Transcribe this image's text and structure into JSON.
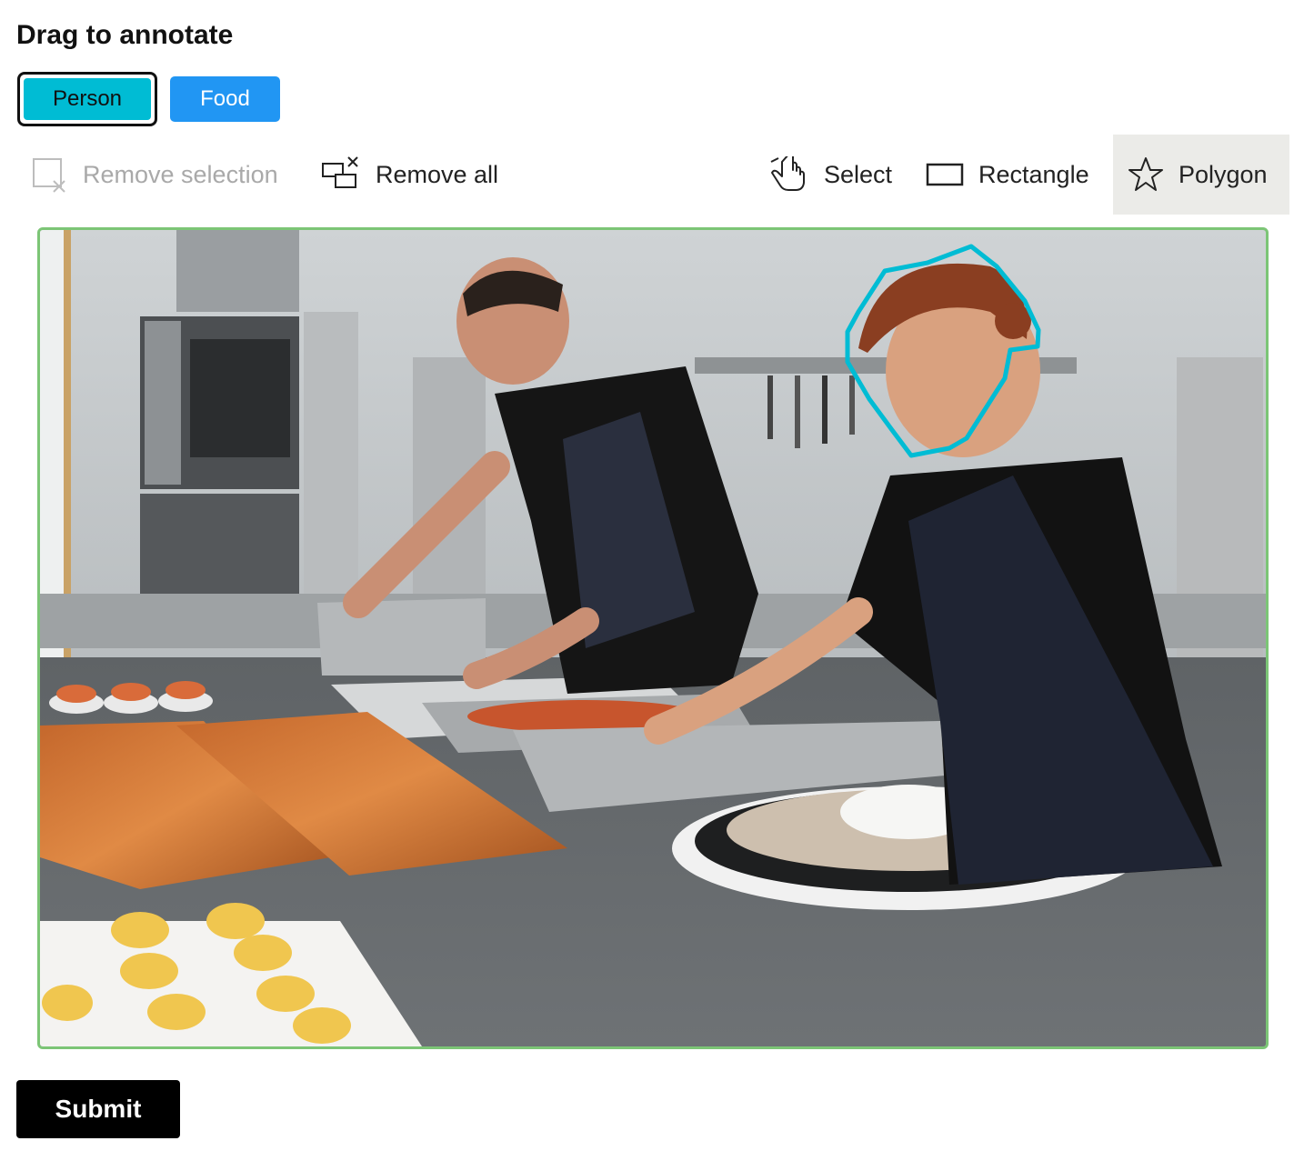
{
  "title": "Drag to annotate",
  "labels": [
    {
      "name": "Person",
      "color": "#00bcd4",
      "selected": true
    },
    {
      "name": "Food",
      "color": "#2196f3",
      "selected": false
    }
  ],
  "toolbar": {
    "remove_selection": "Remove selection",
    "remove_all": "Remove all",
    "select": "Select",
    "rectangle": "Rectangle",
    "polygon": "Polygon",
    "active_tool": "Polygon"
  },
  "annotation": {
    "label": "Person",
    "shape": "polygon",
    "color": "#00bcd4"
  },
  "canvas": {
    "border_color": "#7cc576",
    "image_icon": "kitchen-photo"
  },
  "submit_label": "Submit"
}
